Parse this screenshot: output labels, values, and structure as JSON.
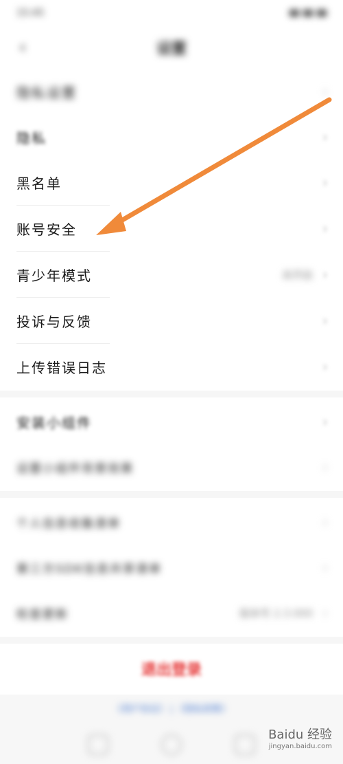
{
  "status_bar": {
    "time": "15:45",
    "signal": "46% 5G 4G"
  },
  "nav": {
    "back": "‹",
    "title": "设置"
  },
  "rows": [
    {
      "label": "隐私设置",
      "blurred": true
    },
    {
      "label": "隐私",
      "blurred": true
    },
    {
      "label": "黑名单",
      "blurred": false
    },
    {
      "label": "账号安全",
      "blurred": false
    },
    {
      "label": "青少年模式",
      "value": "未开启",
      "blurred": false
    },
    {
      "label": "投诉与反馈",
      "blurred": false
    },
    {
      "label": "上传错误日志",
      "blurred": false
    },
    {
      "label": "安装小组件",
      "blurred": true
    },
    {
      "label": "设置小组件背景效果",
      "blurred": true
    },
    {
      "label": "个人信息收集清单",
      "blurred": true
    },
    {
      "label": "第三方SDK信息共享清单",
      "blurred": true
    },
    {
      "label": "检查更新",
      "value": "版本号 2.3.000",
      "blurred": true
    }
  ],
  "logout_label": "退出登录",
  "footer": {
    "links": "《用户协议》 | 《隐私政策》"
  },
  "watermark": {
    "title": "Baidu 经验",
    "sub": "jingyan.baidu.com"
  },
  "colors": {
    "arrow": "#f08a3a",
    "logout": "#e63a3a"
  }
}
